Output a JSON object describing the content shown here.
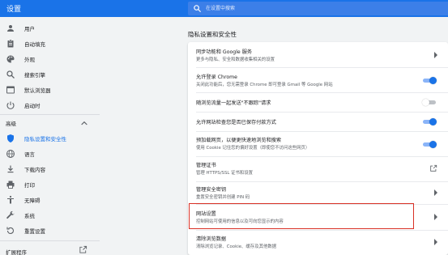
{
  "app": {
    "title": "设置"
  },
  "search": {
    "placeholder": "在设置中搜索"
  },
  "sidebar": {
    "items": [
      {
        "label": "用户",
        "icon": "person-icon"
      },
      {
        "label": "自动填充",
        "icon": "clipboard-icon"
      },
      {
        "label": "外观",
        "icon": "palette-icon"
      },
      {
        "label": "搜索引擎",
        "icon": "search-icon"
      },
      {
        "label": "默认浏览器",
        "icon": "browser-icon"
      },
      {
        "label": "启动时",
        "icon": "power-icon"
      }
    ],
    "advanced_label": "高级",
    "advanced_items": [
      {
        "label": "隐私设置和安全性",
        "icon": "shield-icon",
        "active": true
      },
      {
        "label": "语言",
        "icon": "globe-icon"
      },
      {
        "label": "下载内容",
        "icon": "download-icon"
      },
      {
        "label": "打印",
        "icon": "printer-icon"
      },
      {
        "label": "无障碍",
        "icon": "accessibility-icon"
      },
      {
        "label": "系统",
        "icon": "wrench-icon"
      },
      {
        "label": "重置设置",
        "icon": "reset-icon"
      }
    ],
    "extensions_label": "扩展程序"
  },
  "main": {
    "section_title": "隐私设置和安全性",
    "rows": [
      {
        "title": "同步功能和 Google 服务",
        "subtitle": "更多与隐私、安全和数据收集相关的设置",
        "control": "arrow"
      },
      {
        "title": "允许登录 Chrome",
        "subtitle": "关闭此功能后，您无需登录 Chrome 即可登录 Gmail 等 Google 网站",
        "control": "toggle",
        "on": true
      },
      {
        "title": "随浏览流量一起发送\"不跟踪\"请求",
        "subtitle": "",
        "control": "toggle",
        "on": false
      },
      {
        "title": "允许网站检查您是否已保存付款方式",
        "subtitle": "",
        "control": "toggle",
        "on": true
      },
      {
        "title": "预加载网页，以便更快速地浏览和搜索",
        "subtitle": "使用 Cookie 记住您的偏好设置（即使您不访问这些网页）",
        "control": "toggle",
        "on": true
      },
      {
        "title": "管理证书",
        "subtitle": "管理 HTTPS/SSL 证书和设置",
        "control": "external"
      },
      {
        "title": "管理安全密钥",
        "subtitle": "重置安全密钥并创建 PIN 码",
        "control": "arrow"
      },
      {
        "title": "网站设置",
        "subtitle": "控制网站可使用的信息以及可向您显示的内容",
        "control": "arrow",
        "highlighted": true
      },
      {
        "title": "清除浏览数据",
        "subtitle": "清除浏览记录、Cookie、缓存及其他数据",
        "control": "arrow"
      }
    ]
  },
  "colors": {
    "accent": "#1a73e8",
    "highlight_border": "#d93025",
    "background": "#f1f3f4"
  }
}
